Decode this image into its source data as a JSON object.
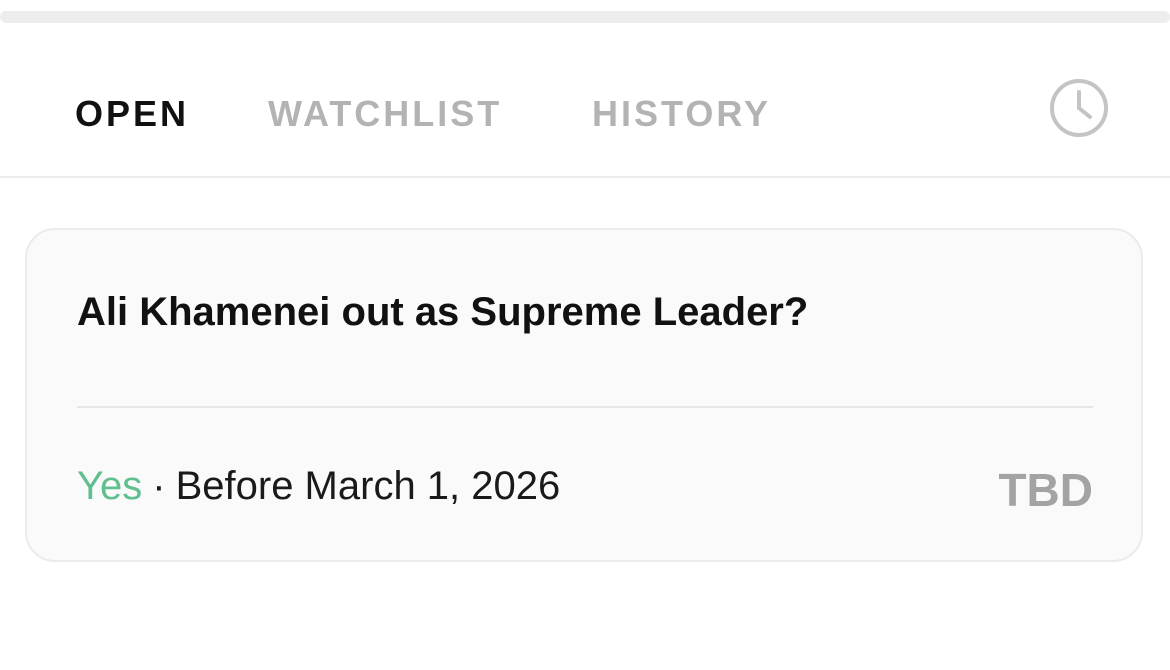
{
  "tabs": [
    {
      "label": "OPEN",
      "active": true
    },
    {
      "label": "WATCHLIST",
      "active": false
    },
    {
      "label": "HISTORY",
      "active": false
    }
  ],
  "header": {
    "clock_icon": "clock-icon"
  },
  "market_card": {
    "title": "Ali Khamenei out as Supreme Leader?",
    "outcome": "Yes",
    "separator": "·",
    "deadline": "Before March 1, 2026",
    "status": "TBD"
  },
  "colors": {
    "active_tab": "#111111",
    "inactive_tab": "#b3b3b3",
    "outcome_yes": "#5fbf8f",
    "status": "#a3a3a3",
    "card_background": "#fafafa"
  }
}
